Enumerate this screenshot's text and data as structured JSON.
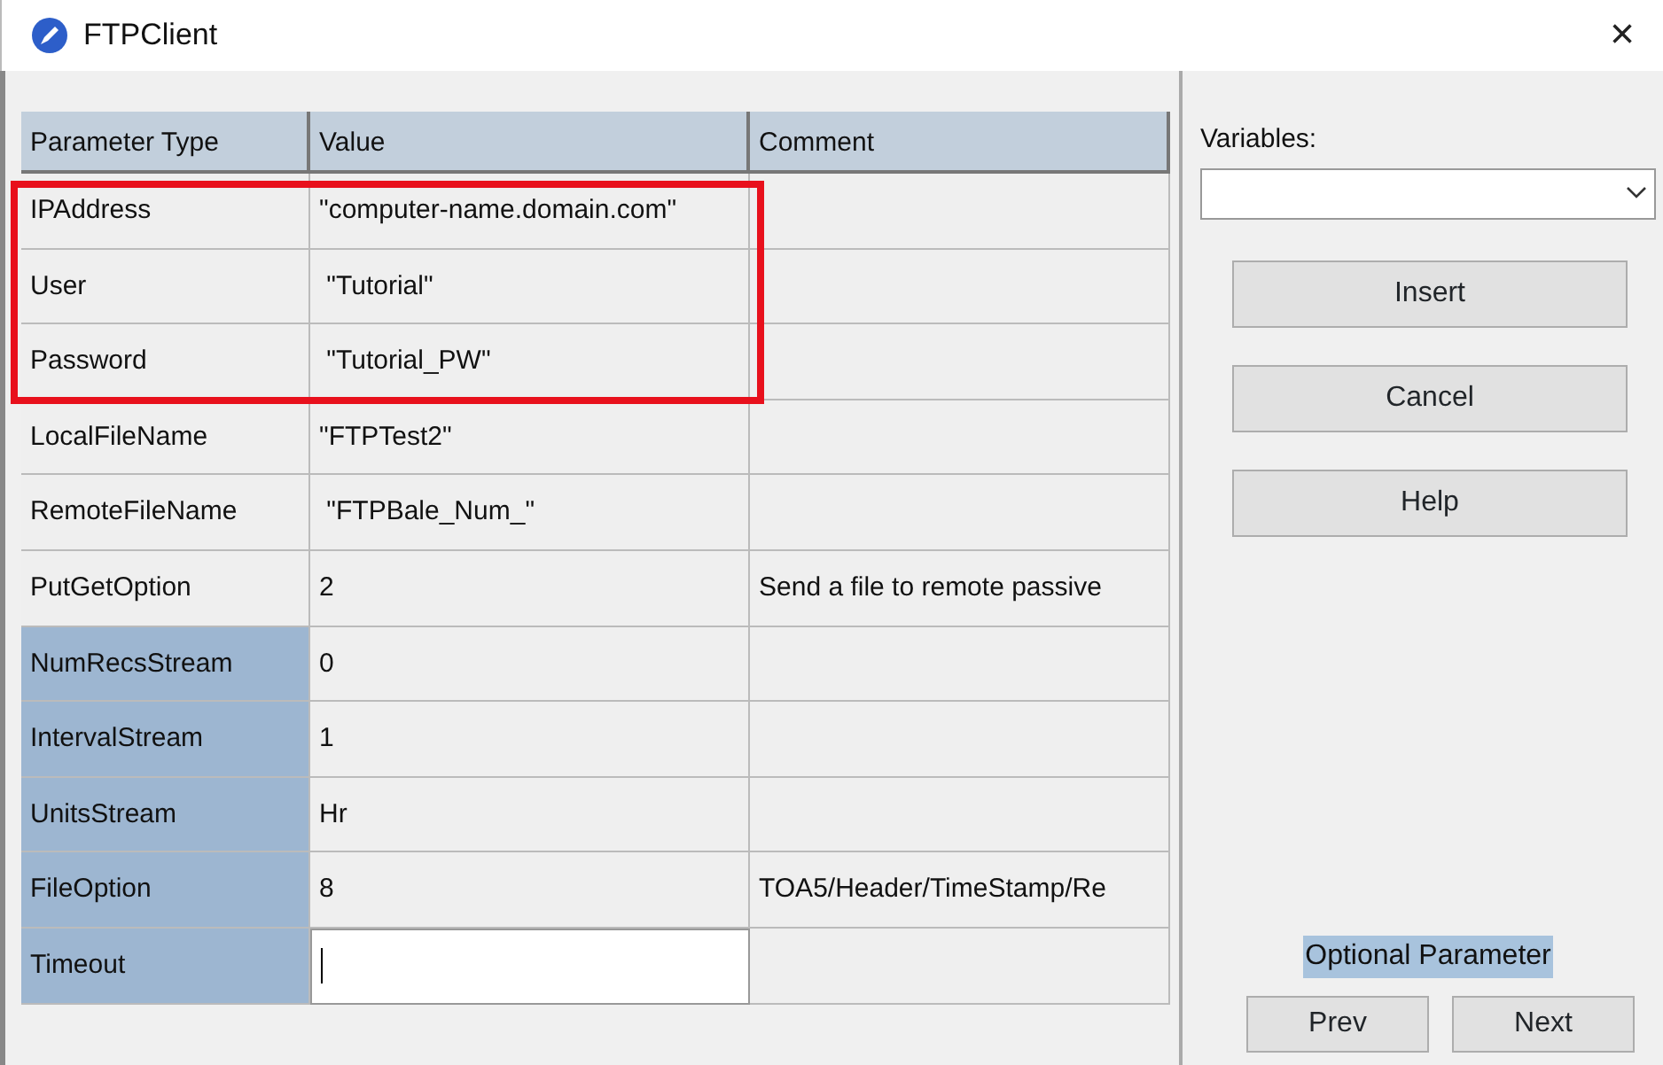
{
  "window": {
    "title": "FTPClient",
    "close": "×"
  },
  "table": {
    "columns": [
      "Parameter Type",
      "Value",
      "Comment"
    ],
    "rows": [
      {
        "parameter": "IPAddress",
        "value": "\"computer-name.domain.com\"",
        "comment": "",
        "optional": false,
        "editing": false,
        "highlighted": true
      },
      {
        "parameter": "User",
        "value": " \"Tutorial\"",
        "comment": "",
        "optional": false,
        "editing": false,
        "highlighted": true
      },
      {
        "parameter": "Password",
        "value": " \"Tutorial_PW\"",
        "comment": "",
        "optional": false,
        "editing": false,
        "highlighted": true
      },
      {
        "parameter": "LocalFileName",
        "value": "\"FTPTest2\"",
        "comment": "",
        "optional": false,
        "editing": false,
        "highlighted": false
      },
      {
        "parameter": "RemoteFileName",
        "value": " \"FTPBale_Num_\"",
        "comment": "",
        "optional": false,
        "editing": false,
        "highlighted": false
      },
      {
        "parameter": "PutGetOption",
        "value": "2",
        "comment": "Send a file to remote passive",
        "optional": false,
        "editing": false,
        "highlighted": false
      },
      {
        "parameter": "NumRecsStream",
        "value": "0",
        "comment": "",
        "optional": true,
        "editing": false,
        "highlighted": false
      },
      {
        "parameter": "IntervalStream",
        "value": "1",
        "comment": "",
        "optional": true,
        "editing": false,
        "highlighted": false
      },
      {
        "parameter": "UnitsStream",
        "value": "Hr",
        "comment": "",
        "optional": true,
        "editing": false,
        "highlighted": false
      },
      {
        "parameter": "FileOption",
        "value": "8",
        "comment": "TOA5/Header/TimeStamp/Re",
        "optional": true,
        "editing": false,
        "highlighted": false
      },
      {
        "parameter": "Timeout",
        "value": "",
        "comment": "",
        "optional": true,
        "editing": true,
        "highlighted": false
      }
    ]
  },
  "variables": {
    "label": "Variables:"
  },
  "buttons": [
    "Insert",
    "Cancel",
    "Help"
  ],
  "optional_label": "Optional Parameter",
  "nav_buttons": [
    "Prev",
    "Next"
  ]
}
